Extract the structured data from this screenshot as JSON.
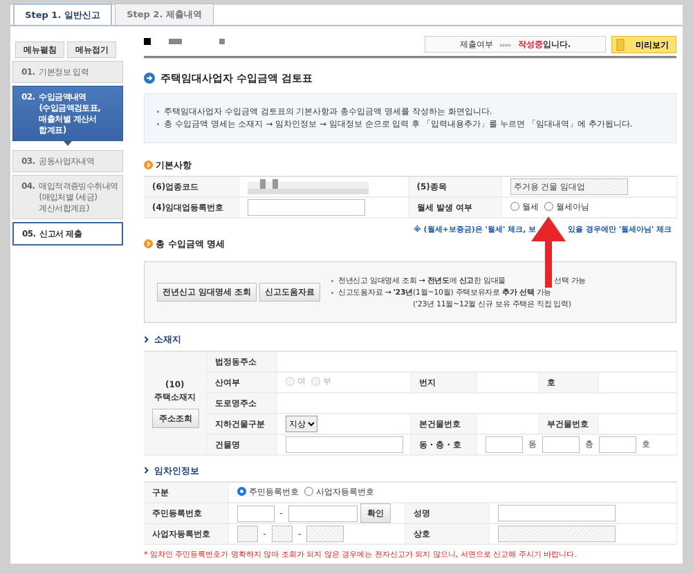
{
  "tabs": [
    {
      "label": "Step 1. 일반신고",
      "selected": true
    },
    {
      "label": "Step 2. 제출내역",
      "selected": false
    }
  ],
  "sidebar": {
    "buttons": [
      "메뉴펼침",
      "메뉴접기"
    ],
    "items": [
      {
        "number": "01.",
        "lines": [
          "기본정보 입력"
        ],
        "selected": false,
        "kind": "normal"
      },
      {
        "number": "02.",
        "lines": [
          "수입금액내역",
          "(수입금액검토표,",
          "매출처별 계산서",
          "합계표)"
        ],
        "selected": true,
        "kind": "normal"
      },
      {
        "number": "03.",
        "lines": [
          "공동사업자내역"
        ],
        "selected": false,
        "kind": "normal"
      },
      {
        "number": "04.",
        "lines": [
          "매입적격증빙수취내역",
          "(매입처별 (세금)",
          "계산서합계표)"
        ],
        "selected": false,
        "kind": "normal"
      },
      {
        "number": "05.",
        "lines": [
          "신고서 제출"
        ],
        "selected": false,
        "kind": "final"
      }
    ]
  },
  "status": {
    "label": "제출여부",
    "arrows": "▸▸▸▸",
    "state": "작성중",
    "suffix": "입니다."
  },
  "preview_button": "미리보기",
  "title": "주택임대사업자 수입금액 검토표",
  "intro": [
    "주택임대사업자 수입금액 검토표의 기본사항과 총수입금액 명세를 작성하는 화면입니다.",
    "총 수입금액 명세는 소재지 → 임차인정보 → 임대정보 순으로 입력 후 「입력내용추가」를 누르면 「임대내역」에 추가됩니다."
  ],
  "basic": {
    "heading": "기본사항",
    "rows": [
      [
        {
          "kind": "label",
          "text": "(6)업종코드"
        },
        {
          "kind": "redacted"
        },
        {
          "kind": "label",
          "text": "(5)종목"
        },
        {
          "kind": "value",
          "parts": [
            {
              "kind": "input",
              "value": "주거용 건물 임대업",
              "disabled": true
            }
          ]
        }
      ],
      [
        {
          "kind": "label",
          "text": "(4)임대업등록번호"
        },
        {
          "kind": "value",
          "parts": [
            {
              "kind": "input",
              "disabled": false
            }
          ]
        },
        {
          "kind": "label",
          "text": "월세 발생 여부"
        },
        {
          "kind": "value",
          "parts": [
            {
              "kind": "radio",
              "label": "월세",
              "selected": false,
              "disabled": false
            },
            {
              "kind": "radio",
              "label": "월세아님",
              "selected": false,
              "disabled": false
            }
          ]
        }
      ]
    ],
    "note": [
      "※ (월세+보증금)은 '월세' 체크, 보",
      "있을 경우에만 '월세아님' 체크"
    ]
  },
  "totals": {
    "heading": "총 수입금액 명세",
    "buttons": [
      "전년신고 임대명세 조회",
      "신고도움자료"
    ],
    "lines": [
      {
        "kind": "bullet",
        "parts": [
          "전년신고 임대명세 조회 → **전년도**에  **신고**한 임대물",
          "선택 가능"
        ]
      },
      {
        "kind": "bullet",
        "parts": [
          "신고도움자료 → **'23년**(1월~10월) 주택보유자로 **추가 선택** 가능"
        ]
      },
      {
        "kind": "continued",
        "parts": [
          "('23년 11월~12월 신규 보유 주택은 직접 입력)"
        ]
      }
    ]
  },
  "location": {
    "heading": "소재지",
    "side": {
      "lines": [
        "(10)",
        "주택소재지"
      ],
      "button": "주소조회"
    },
    "rows": [
      [
        {
          "kind": "label",
          "text": "법정동주소"
        },
        {
          "kind": "empty",
          "colspan": 5
        }
      ],
      [
        {
          "kind": "label",
          "text": "산여부"
        },
        {
          "kind": "value",
          "parts": [
            {
              "kind": "radio",
              "label": "여",
              "selected": false,
              "disabled": true
            },
            {
              "kind": "radio",
              "label": "부",
              "selected": false,
              "disabled": true
            }
          ]
        },
        {
          "kind": "label",
          "text": "번지"
        },
        {
          "kind": "empty"
        },
        {
          "kind": "label",
          "text": "호"
        },
        {
          "kind": "empty"
        }
      ],
      [
        {
          "kind": "label",
          "text": "도로명주소"
        },
        {
          "kind": "empty",
          "colspan": 5
        }
      ],
      [
        {
          "kind": "label",
          "text": "지하건물구분"
        },
        {
          "kind": "value",
          "parts": [
            {
              "kind": "select",
              "value": "지상"
            }
          ]
        },
        {
          "kind": "label",
          "text": "본건물번호"
        },
        {
          "kind": "empty"
        },
        {
          "kind": "label",
          "text": "부건물번호"
        },
        {
          "kind": "empty"
        }
      ],
      [
        {
          "kind": "label",
          "text": "건물명"
        },
        {
          "kind": "value",
          "parts": [
            {
              "kind": "input",
              "disabled": false
            }
          ]
        },
        {
          "kind": "label",
          "text": "동 · 층 · 호"
        },
        {
          "kind": "value",
          "colspan": 3,
          "parts": [
            {
              "kind": "input",
              "disabled": false
            },
            {
              "kind": "text",
              "text": "동"
            },
            {
              "kind": "input",
              "disabled": false
            },
            {
              "kind": "text",
              "text": "층"
            },
            {
              "kind": "input",
              "disabled": false
            },
            {
              "kind": "text",
              "text": "호"
            }
          ]
        }
      ]
    ]
  },
  "tenant": {
    "heading": "임차인정보",
    "rows": [
      [
        {
          "kind": "label",
          "text": "구분"
        },
        {
          "kind": "value",
          "colspan": 3,
          "parts": [
            {
              "kind": "radio",
              "label": "주민등록번호",
              "selected": true,
              "disabled": false
            },
            {
              "kind": "radio",
              "label": "사업자등록번호",
              "selected": false,
              "disabled": false
            }
          ]
        }
      ],
      [
        {
          "kind": "label",
          "text": "주민등록번호"
        },
        {
          "kind": "value",
          "parts": [
            {
              "kind": "input",
              "disabled": false
            },
            {
              "kind": "text",
              "text": "-"
            },
            {
              "kind": "input",
              "disabled": false
            },
            {
              "kind": "button",
              "text": "확인"
            }
          ]
        },
        {
          "kind": "label",
          "text": "성명"
        },
        {
          "kind": "value",
          "parts": [
            {
              "kind": "input",
              "disabled": false
            }
          ]
        }
      ],
      [
        {
          "kind": "label",
          "text": "사업자등록번호"
        },
        {
          "kind": "value",
          "parts": [
            {
              "kind": "input",
              "disabled": true
            },
            {
              "kind": "text",
              "text": "-"
            },
            {
              "kind": "input",
              "disabled": true
            },
            {
              "kind": "text",
              "text": "-"
            },
            {
              "kind": "input",
              "disabled": true
            }
          ]
        },
        {
          "kind": "label",
          "text": "상호"
        },
        {
          "kind": "value",
          "parts": [
            {
              "kind": "input",
              "disabled": true
            }
          ]
        }
      ]
    ]
  },
  "footer_note": "* 임차인 주민등록번호가 명확하지 않아 조회가 되지 않은 경우에는 전자신고가 되지 않으니, 서면으로 신고해 주시기 바랍니다."
}
